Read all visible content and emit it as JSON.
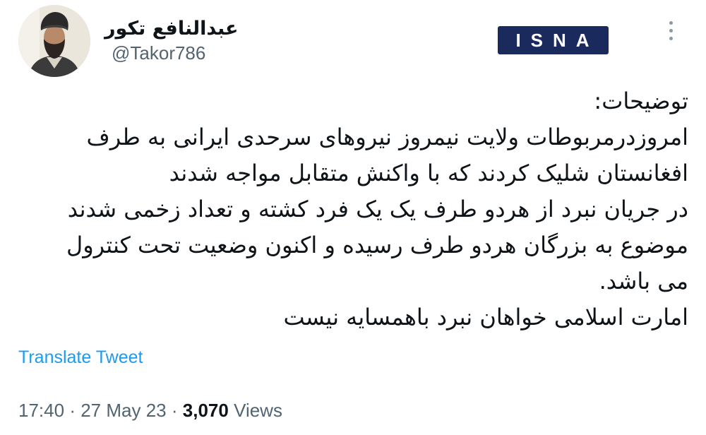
{
  "author": {
    "name": "عبدالنافع تکور",
    "handle": "@Takor786"
  },
  "badge": {
    "label": "ISNA",
    "color": "#1b2a5c"
  },
  "menu": {
    "icon": "more-vertical-icon"
  },
  "tweet": {
    "lines": [
      "توضیحات:",
      "امروزدرمربوطات ولایت نیمروز نیروهای سرحدی ایرانی به طرف",
      "افغانستان شلیک کردند که با واکنش متقابل مواجه شدند",
      "در جریان نبرد از هردو طرف یک یک فرد کشته و تعداد زخمی شدند",
      "موضوع به بزرگان هردو طرف رسیده و اکنون وضعیت تحت کنترول",
      "می باشد.",
      "امارت اسلامی خواهان نبرد باهمسایه نیست"
    ]
  },
  "translate_label": "Translate Tweet",
  "meta": {
    "time": "17:40",
    "separator": "·",
    "date": "27 May 23",
    "views_count": "3,070",
    "views_label": "Views"
  },
  "colors": {
    "link": "#1d9bf0",
    "secondary_text": "#536471",
    "primary_text": "#0f1419"
  }
}
